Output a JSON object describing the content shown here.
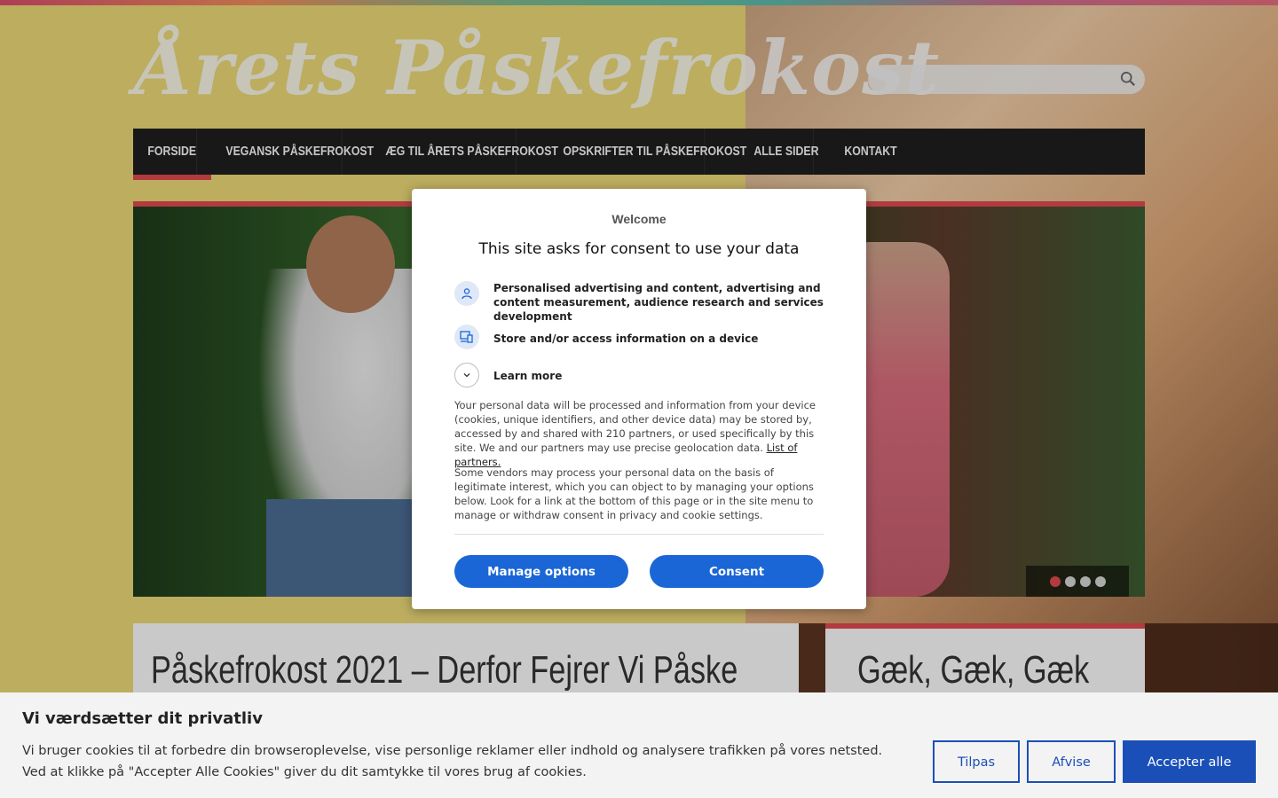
{
  "site": {
    "title": "Årets Påskefrokost",
    "search_placeholder": ""
  },
  "nav": {
    "items": [
      {
        "label": "FORSIDE",
        "active": true
      },
      {
        "label": "VEGANSK PÅSKEFROKOST"
      },
      {
        "label": "ÆG TIL ÅRETS PÅSKEFROKOST"
      },
      {
        "label": "OPSKRIFTER TIL PÅSKEFROKOST"
      },
      {
        "label": "ALLE SIDER"
      },
      {
        "label": "KONTAKT"
      }
    ]
  },
  "slider": {
    "slide_count": 4,
    "active_index": 0
  },
  "posts": {
    "left_title": "Påskefrokost 2021 – Derfor Fejrer Vi Påske",
    "right_title": "Gæk, Gæk, Gæk"
  },
  "consent_modal": {
    "welcome": "Welcome",
    "title": "This site asks for consent to use your data",
    "purposes": [
      {
        "icon": "person-icon",
        "text": "Personalised advertising and content, advertising and content measurement, audience research and services development"
      },
      {
        "icon": "devices-icon",
        "text": "Store and/or access information on a device"
      }
    ],
    "learn_more": "Learn more",
    "para1": "Your personal data will be processed and information from your device (cookies, unique identifiers, and other device data) may be stored by, accessed by and shared with 210 partners, or used specifically by this site. We and our partners may use precise geolocation data.",
    "partners_link": "List of partners.",
    "para2": "Some vendors may process your personal data on the basis of legitimate interest, which you can object to by managing your options below. Look for a link at the bottom of this page or in the site menu to manage or withdraw consent in privacy and cookie settings.",
    "manage_button": "Manage options",
    "consent_button": "Consent"
  },
  "cookie_bar": {
    "title": "Vi værdsætter dit privatliv",
    "text": "Vi bruger cookies til at forbedre din browseroplevelse, vise personlige reklamer eller indhold og analysere trafikken på vores netsted. Ved at klikke på \"Accepter Alle Cookies\" giver du dit samtykke til vores brug af cookies.",
    "customize_button": "Tilpas",
    "reject_button": "Afvise",
    "accept_button": "Accepter alle"
  },
  "colors": {
    "accent_red": "#d9484d",
    "nav_bg": "#1e1e1e",
    "modal_button": "#1a66d6",
    "cookie_button": "#1b4fb8"
  }
}
